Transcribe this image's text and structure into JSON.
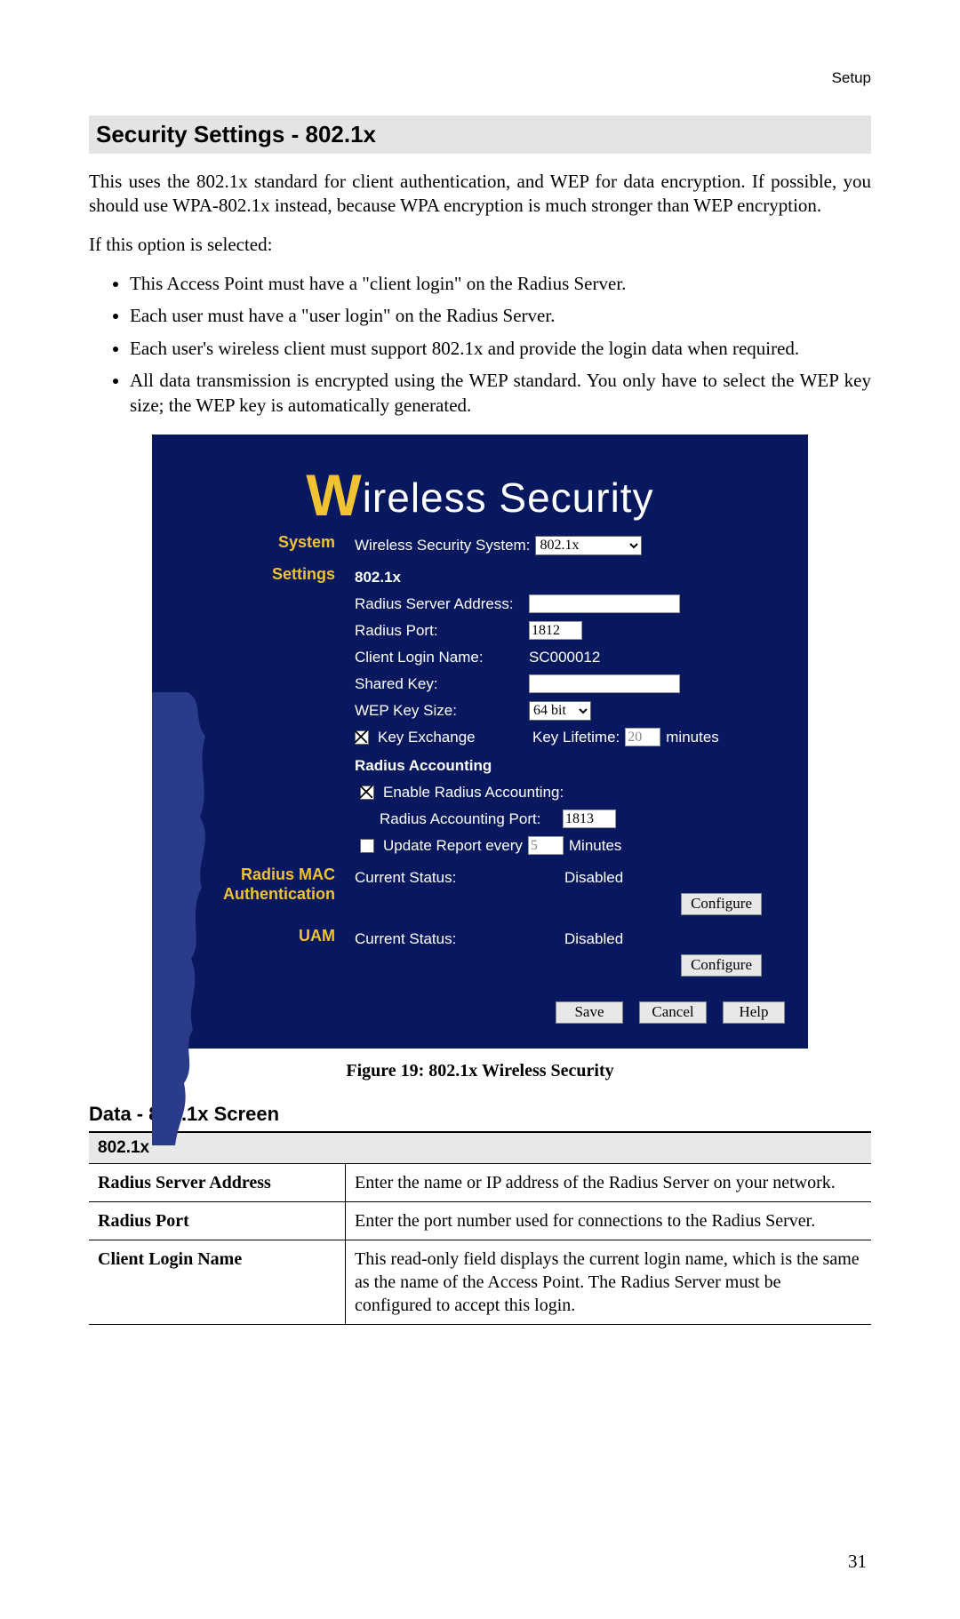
{
  "page": {
    "setup_label": "Setup",
    "section_title": "Security Settings - 802.1x",
    "intro": "This uses the 802.1x standard for client authentication, and WEP for data encryption. If possible, you should use WPA-802.1x instead, because WPA encryption is much stronger than WEP encryption.",
    "if_selected": "If this option is selected:",
    "bullets": [
      "This Access Point must have a \"client login\" on the Radius Server.",
      "Each user must have a \"user login\" on the Radius Server.",
      "Each user's wireless client must support 802.1x and provide the login data when required.",
      "All data transmission is encrypted using the WEP standard. You only have to select the WEP key size; the WEP key is automatically generated."
    ],
    "figure_caption": "Figure 19: 802.1x Wireless Security",
    "data_heading": "Data - 802.1x Screen",
    "page_number": "31"
  },
  "panel": {
    "title_rest": "ireless Security",
    "title_w": "W",
    "side": {
      "system": "System",
      "settings": "Settings",
      "radius_mac_auth_l1": "Radius MAC",
      "radius_mac_auth_l2": "Authentication",
      "uam": "UAM"
    },
    "system_row": {
      "label": "Wireless Security System:",
      "value": "802.1x"
    },
    "settings": {
      "heading": "802.1x",
      "radius_server_address_label": "Radius Server Address:",
      "radius_server_address_value": "",
      "radius_port_label": "Radius Port:",
      "radius_port_value": "1812",
      "client_login_name_label": "Client Login Name:",
      "client_login_name_value": "SC000012",
      "shared_key_label": "Shared Key:",
      "shared_key_value": "",
      "wep_key_size_label": "WEP Key Size:",
      "wep_key_size_value": "64 bit",
      "key_exchange_label": "Key Exchange",
      "key_lifetime_label": "Key Lifetime:",
      "key_lifetime_value": "20",
      "key_lifetime_units": "minutes",
      "radius_accounting_heading": "Radius Accounting",
      "enable_radius_accounting_label": "Enable Radius Accounting:",
      "radius_accounting_port_label": "Radius Accounting Port:",
      "radius_accounting_port_value": "1813",
      "update_report_label": "Update Report every",
      "update_report_value": "5",
      "update_report_units": "Minutes"
    },
    "radius_mac": {
      "current_status_label": "Current Status:",
      "current_status_value": "Disabled",
      "configure_label": "Configure"
    },
    "uam": {
      "current_status_label": "Current Status:",
      "current_status_value": "Disabled",
      "configure_label": "Configure"
    },
    "buttons": {
      "save": "Save",
      "cancel": "Cancel",
      "help": "Help"
    }
  },
  "table": {
    "header": "802.1x",
    "rows": [
      {
        "label": "Radius Server Address",
        "desc": "Enter the name or IP address of the Radius Server on your network."
      },
      {
        "label": "Radius Port",
        "desc": "Enter the port number used for connections to the Radius Server."
      },
      {
        "label": "Client Login Name",
        "desc": "This read-only field displays the current login name, which is the same as the name of the Access Point. The Radius Server must be configured to accept this login."
      }
    ]
  }
}
